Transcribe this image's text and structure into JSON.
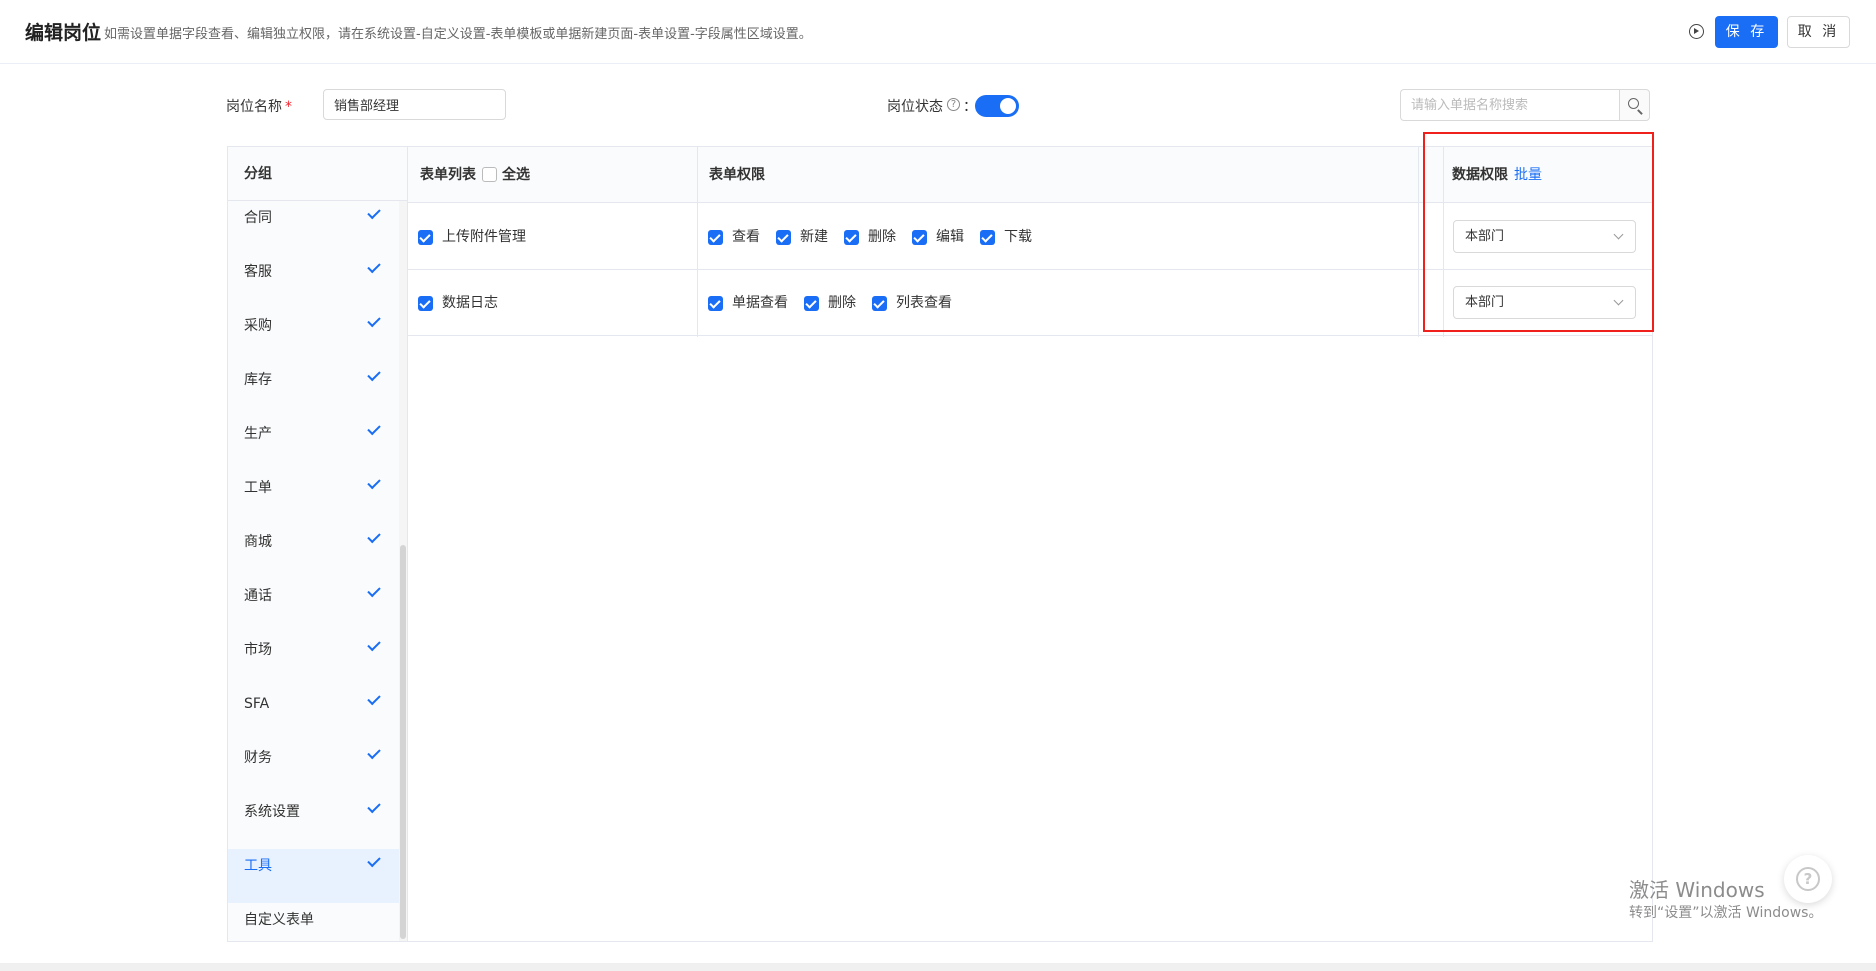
{
  "header": {
    "title": "编辑岗位",
    "description": "如需设置单据字段查看、编辑独立权限，请在系统设置-自定义设置-表单模板或单据新建页面-表单设置-字段属性区域设置。",
    "save_label": "保 存",
    "cancel_label": "取 消"
  },
  "form": {
    "name_label": "岗位名称",
    "required_mark": "*",
    "name_value": "销售部经理",
    "status_label": "岗位状态",
    "help_glyph": "?",
    "colon": "：",
    "status_on": true,
    "search_placeholder": "请输入单据名称搜索"
  },
  "groups": {
    "header": "分组",
    "items": [
      {
        "label": "合同",
        "checked": true
      },
      {
        "label": "客服",
        "checked": true
      },
      {
        "label": "采购",
        "checked": true
      },
      {
        "label": "库存",
        "checked": true
      },
      {
        "label": "生产",
        "checked": true
      },
      {
        "label": "工单",
        "checked": true
      },
      {
        "label": "商城",
        "checked": true
      },
      {
        "label": "通话",
        "checked": true
      },
      {
        "label": "市场",
        "checked": true
      },
      {
        "label": "SFA",
        "checked": true
      },
      {
        "label": "财务",
        "checked": true
      },
      {
        "label": "系统设置",
        "checked": true
      },
      {
        "label": "工具",
        "checked": true,
        "active": true
      },
      {
        "label": "自定义表单",
        "checked": false
      }
    ]
  },
  "table": {
    "col_form_list": "表单列表",
    "select_all": "全选",
    "col_form_perm": "表单权限",
    "col_data_perm": "数据权限",
    "batch_link": "批量",
    "rows": [
      {
        "name": "上传附件管理",
        "perms": [
          "查看",
          "新建",
          "删除",
          "编辑",
          "下载"
        ],
        "data_perm": "本部门"
      },
      {
        "name": "数据日志",
        "perms": [
          "单据查看",
          "删除",
          "列表查看"
        ],
        "data_perm": "本部门"
      }
    ]
  },
  "watermark": {
    "line1": "激活 Windows",
    "line2": "转到“设置”以激活 Windows。"
  },
  "help_float_glyph": "?"
}
